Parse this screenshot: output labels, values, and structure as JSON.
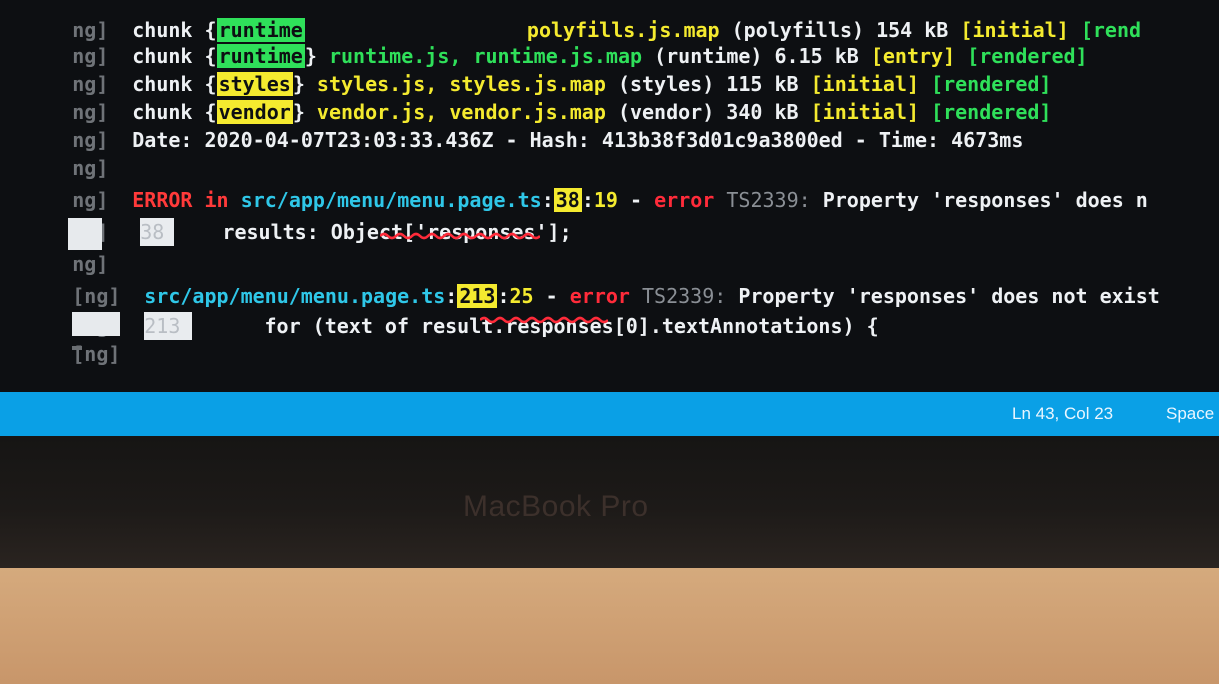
{
  "terminal": {
    "prefixes": [
      "ng]",
      "ng]",
      "ng]",
      "ng]",
      "ng]",
      "ng]",
      "ng]",
      "ng]",
      "ng]",
      "[ng]",
      "[ng]",
      "[ng]"
    ],
    "chunk_runtime": {
      "chunk": "chunk",
      "open": "{",
      "name": "runtime",
      "close": "}",
      "files": "runtime.js, runtime.js.map",
      "desc": "(runtime) 6.15 kB",
      "flag": "[entry]",
      "rendered": "[rendered]"
    },
    "chunk_styles": {
      "chunk": "chunk",
      "open": "{",
      "name": "styles",
      "close": "}",
      "files": "styles.js, styles.js.map",
      "desc": "(styles) 115 kB",
      "flag": "[initial]",
      "rendered": "[rendered]"
    },
    "chunk_vendor": {
      "chunk": "chunk",
      "open": "{",
      "name": "vendor",
      "close": "}",
      "files": "vendor.js, vendor.js.map",
      "desc": "(vendor) 340 kB",
      "flag": "[initial]",
      "rendered": "[rendered]"
    },
    "partial_top": {
      "chunk": "chunk",
      "open": "{",
      "name": "runtime",
      "files": "polyfills.js.map",
      "desc": "(polyfills) 154 kB",
      "flag": "[initial]",
      "rendered": "[rend"
    },
    "date_line": {
      "date_label": "Date:",
      "date": "2020-04-07T23:03:33.436Z",
      "dash1": "-",
      "hash_label": "Hash:",
      "hash": "413b38f3d01c9a3800ed",
      "dash2": "-",
      "time_label": "Time:",
      "time": "4673ms"
    },
    "error1": {
      "error_word": "ERROR",
      "in_word": "in",
      "path": "src/app/menu/menu.page.ts",
      "colon1": ":",
      "line": "38",
      "colon2": ":",
      "col": "19",
      "dash": "-",
      "error_label": "error",
      "code": "TS2339:",
      "message": "Property 'responses' does n",
      "gutter": "38",
      "source": "results: Object['responses'];"
    },
    "error2": {
      "path": "src/app/menu/menu.page.ts",
      "colon1": ":",
      "line": "213",
      "colon2": ":",
      "col": "25",
      "dash": "-",
      "error_label": "error",
      "code": "TS2339:",
      "message": "Property 'responses' does not exist",
      "gutter": "213",
      "source_before": "for (text of result.",
      "source_highlight": "responses",
      "source_after": "[0].textAnnotations) {"
    }
  },
  "statusbar": {
    "position": "Ln 43, Col 23",
    "spaces": "Space"
  },
  "bezel": {
    "brand": "MacBook Pro"
  },
  "colors": {
    "terminal_bg": "#0d0f12",
    "green": "#2fe05a",
    "yellow": "#f4ea2f",
    "cyan": "#2fc7e8",
    "red": "#ff2b3a",
    "statusbar": "#0aa0e6"
  }
}
